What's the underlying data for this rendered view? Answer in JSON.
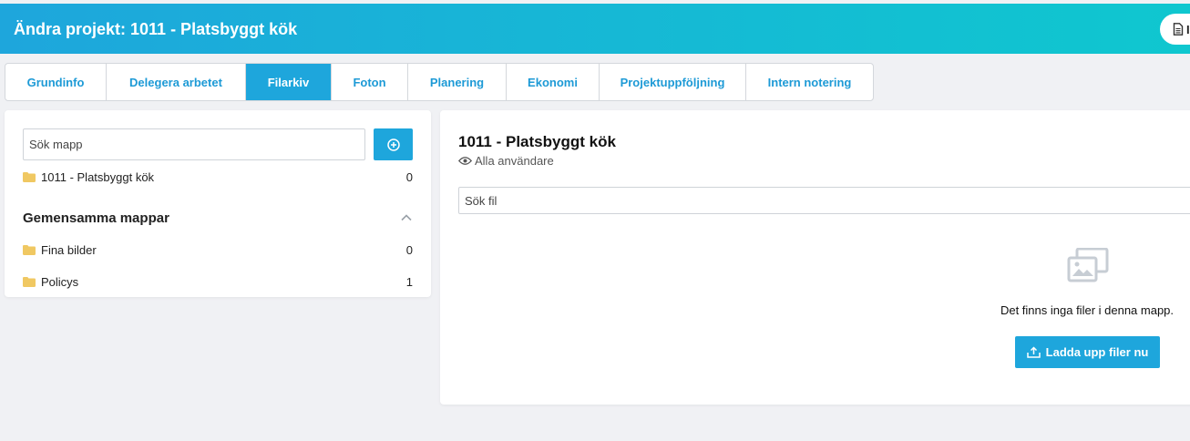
{
  "header": {
    "title": "Ändra projekt: 1011 - Platsbyggt kök",
    "action_label": "I"
  },
  "tabs": [
    {
      "label": "Grundinfo",
      "active": false
    },
    {
      "label": "Delegera arbetet",
      "active": false
    },
    {
      "label": "Filarkiv",
      "active": true
    },
    {
      "label": "Foton",
      "active": false
    },
    {
      "label": "Planering",
      "active": false
    },
    {
      "label": "Ekonomi",
      "active": false
    },
    {
      "label": "Projektuppföljning",
      "active": false
    },
    {
      "label": "Intern notering",
      "active": false
    }
  ],
  "folders_panel": {
    "search_placeholder": "Sök mapp",
    "project_folder": {
      "name": "1011 - Platsbyggt kök",
      "count": "0"
    },
    "shared_title": "Gemensamma mappar",
    "shared_folders": [
      {
        "name": "Fina bilder",
        "count": "0"
      },
      {
        "name": "Policys",
        "count": "1"
      }
    ]
  },
  "files_panel": {
    "folder_title": "1011 - Platsbyggt kök",
    "visibility": "Alla användare",
    "search_placeholder": "Sök fil",
    "empty_text": "Det finns inga filer i denna mapp.",
    "upload_label": "Ladda upp filer nu"
  },
  "colors": {
    "accent": "#1ea6dc",
    "header_gradient_end": "#0fc7cf",
    "folder": "#f0c862",
    "background": "#f0f1f4"
  },
  "icons": [
    "document-icon",
    "plus-circle-icon",
    "folder-icon",
    "chevron-up-icon",
    "eye-icon",
    "images-icon",
    "upload-icon"
  ]
}
